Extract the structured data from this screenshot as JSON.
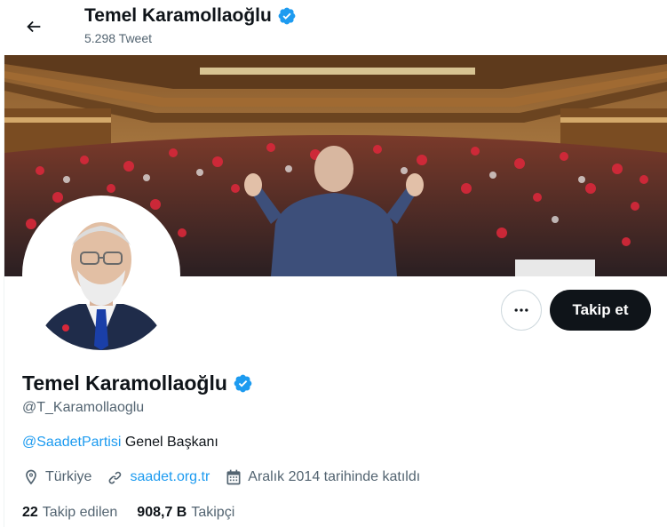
{
  "header": {
    "name": "Temel Karamollaoğlu",
    "tweet_count": "5.298 Tweet"
  },
  "profile": {
    "name": "Temel Karamollaoğlu",
    "handle": "@T_Karamollaoglu",
    "bio_mention": "@SaadetPartisi",
    "bio_text": " Genel Başkanı",
    "location": "Türkiye",
    "website": "saadet.org.tr",
    "joined": "Aralık 2014 tarihinde katıldı"
  },
  "actions": {
    "follow_label": "Takip et"
  },
  "stats": {
    "following_count": "22",
    "following_label": "Takip edilen",
    "followers_count": "908,7 B",
    "followers_label": "Takipçi"
  },
  "colors": {
    "accent": "#1d9bf0",
    "text": "#0f1419",
    "muted": "#536471",
    "follow_bg": "#0f1419"
  },
  "icons": [
    "back-arrow-icon",
    "verified-badge-icon",
    "more-icon",
    "location-icon",
    "link-icon",
    "calendar-icon"
  ]
}
